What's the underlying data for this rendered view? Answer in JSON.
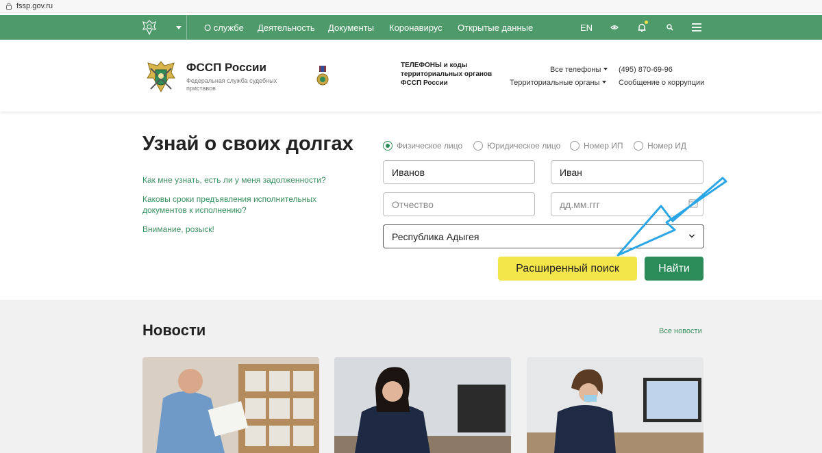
{
  "browser": {
    "url": "fssp.gov.ru"
  },
  "nav": {
    "menu": [
      "О службе",
      "Деятельность",
      "Документы",
      "Коронавирус",
      "Открытые данные"
    ],
    "lang": "EN"
  },
  "header": {
    "brand": "ФССП России",
    "brand_sub": "Федеральная служба судебных приставов",
    "phones_title": "ТЕЛЕФОНЫ и коды территориальных органов ФССП России",
    "all_phones": "Все телефоны",
    "territorial": "Территориальные органы",
    "phone": "(495) 870-69-96",
    "corruption": "Сообщение о коррупции"
  },
  "hero": {
    "title": "Узнай о своих долгах",
    "links": [
      "Как мне узнать, есть ли у меня задолженности?",
      "Каковы сроки предъявления исполнительных документов к исполнению?",
      "Внимание, розыск!"
    ]
  },
  "search": {
    "radios": [
      {
        "label": "Физическое лицо",
        "checked": true
      },
      {
        "label": "Юридическое лицо",
        "checked": false
      },
      {
        "label": "Номер ИП",
        "checked": false
      },
      {
        "label": "Номер ИД",
        "checked": false
      }
    ],
    "last_name": "Иванов",
    "first_name": "Иван",
    "patronymic_placeholder": "Отчество",
    "date_placeholder": "дд.мм.ггг",
    "region": "Республика Адыгея",
    "advanced_label": "Расширенный поиск",
    "find_label": "Найти"
  },
  "news": {
    "title": "Новости",
    "all": "Все новости"
  },
  "colors": {
    "nav_green": "#4e9a6a",
    "link_green": "#3b8f5f",
    "button_green": "#2b8c5a",
    "button_yellow": "#f3e64a",
    "arrow_blue": "#2aa6e6"
  }
}
